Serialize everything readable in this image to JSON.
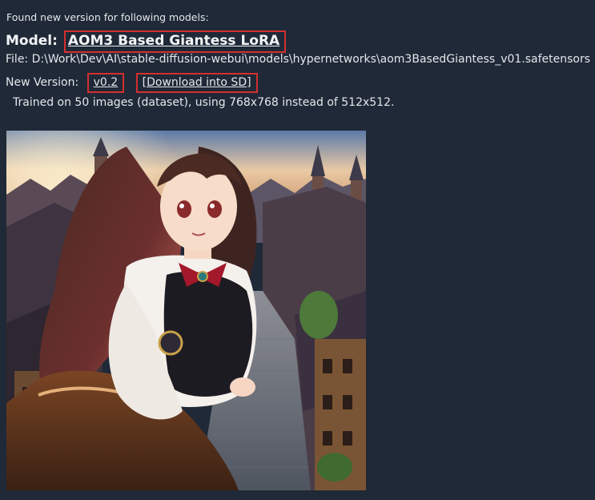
{
  "notice": {
    "header": "Found new version for following models:",
    "model_label": "Model:",
    "model_name": "AOM3 Based Giantess LoRA",
    "file_label": "File:",
    "file_path": "D:\\Work\\Dev\\AI\\stable-diffusion-webui\\models\\hypernetworks\\aom3BasedGiantess_v01.safetensors",
    "new_version_label": "New Version:",
    "new_version": "v0.2",
    "download_label": "[Download into SD]",
    "description": "Trained on 50 images (dataset), using 768x768 instead of 512x512."
  },
  "colors": {
    "background": "#1f2937",
    "highlight_box": "#d32f2f",
    "text": "#e5e7eb"
  }
}
